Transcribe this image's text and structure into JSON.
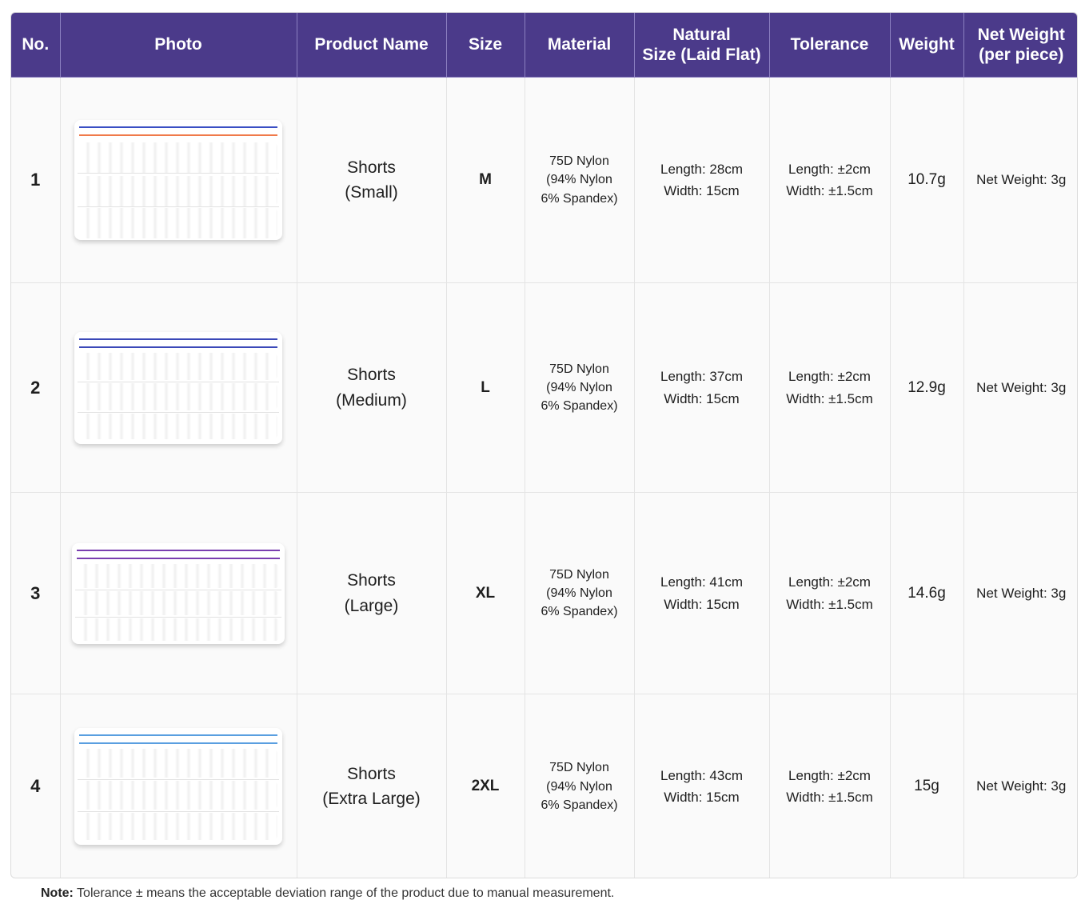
{
  "headers": {
    "no": "No.",
    "photo": "Photo",
    "product_name": "Product Name",
    "size": "Size",
    "material": "Material",
    "natural_size_line1": "Natural",
    "natural_size_line2": "Size (Laid Flat)",
    "tolerance": "Tolerance",
    "weight": "Weight",
    "net_weight_line1": "Net Weight",
    "net_weight_line2": "(per piece)"
  },
  "colors": {
    "header_bg": "#4b3a8a",
    "row1_band_primary": "#3a4fc4",
    "row1_band_secondary": "#f07a4a",
    "row2_band": "#3b49b8",
    "row3_band": "#7a3fb0",
    "row4_band": "#5a9fe0"
  },
  "rows": [
    {
      "no": "1",
      "name_line1": "Shorts",
      "name_line2": "(Small)",
      "size": "M",
      "material_line1": "75D Nylon",
      "material_line2": "(94% Nylon",
      "material_line3": "6% Spandex)",
      "length": "Length: 28cm",
      "width": "Width: 15cm",
      "tol_length": "Length: ±2cm",
      "tol_width": "Width: ±1.5cm",
      "weight": "10.7g",
      "net_weight": "Net Weight: 3g"
    },
    {
      "no": "2",
      "name_line1": "Shorts",
      "name_line2": "(Medium)",
      "size": "L",
      "material_line1": "75D Nylon",
      "material_line2": "(94% Nylon",
      "material_line3": "6% Spandex)",
      "length": "Length: 37cm",
      "width": "Width: 15cm",
      "tol_length": "Length: ±2cm",
      "tol_width": "Width: ±1.5cm",
      "weight": "12.9g",
      "net_weight": "Net Weight: 3g"
    },
    {
      "no": "3",
      "name_line1": "Shorts",
      "name_line2": "(Large)",
      "size": "XL",
      "material_line1": "75D Nylon",
      "material_line2": "(94% Nylon",
      "material_line3": "6% Spandex)",
      "length": "Length: 41cm",
      "width": "Width: 15cm",
      "tol_length": "Length: ±2cm",
      "tol_width": "Width: ±1.5cm",
      "weight": "14.6g",
      "net_weight": "Net Weight: 3g"
    },
    {
      "no": "4",
      "name_line1": "Shorts",
      "name_line2": "(Extra Large)",
      "size": "2XL",
      "material_line1": "75D Nylon",
      "material_line2": "(94% Nylon",
      "material_line3": "6% Spandex)",
      "length": "Length: 43cm",
      "width": "Width: 15cm",
      "tol_length": "Length: ±2cm",
      "tol_width": "Width: ±1.5cm",
      "weight": "15g",
      "net_weight": "Net Weight: 3g"
    }
  ],
  "note": {
    "label": "Note:",
    "text": "Tolerance ± means the acceptable deviation range of the product due to manual measurement."
  }
}
